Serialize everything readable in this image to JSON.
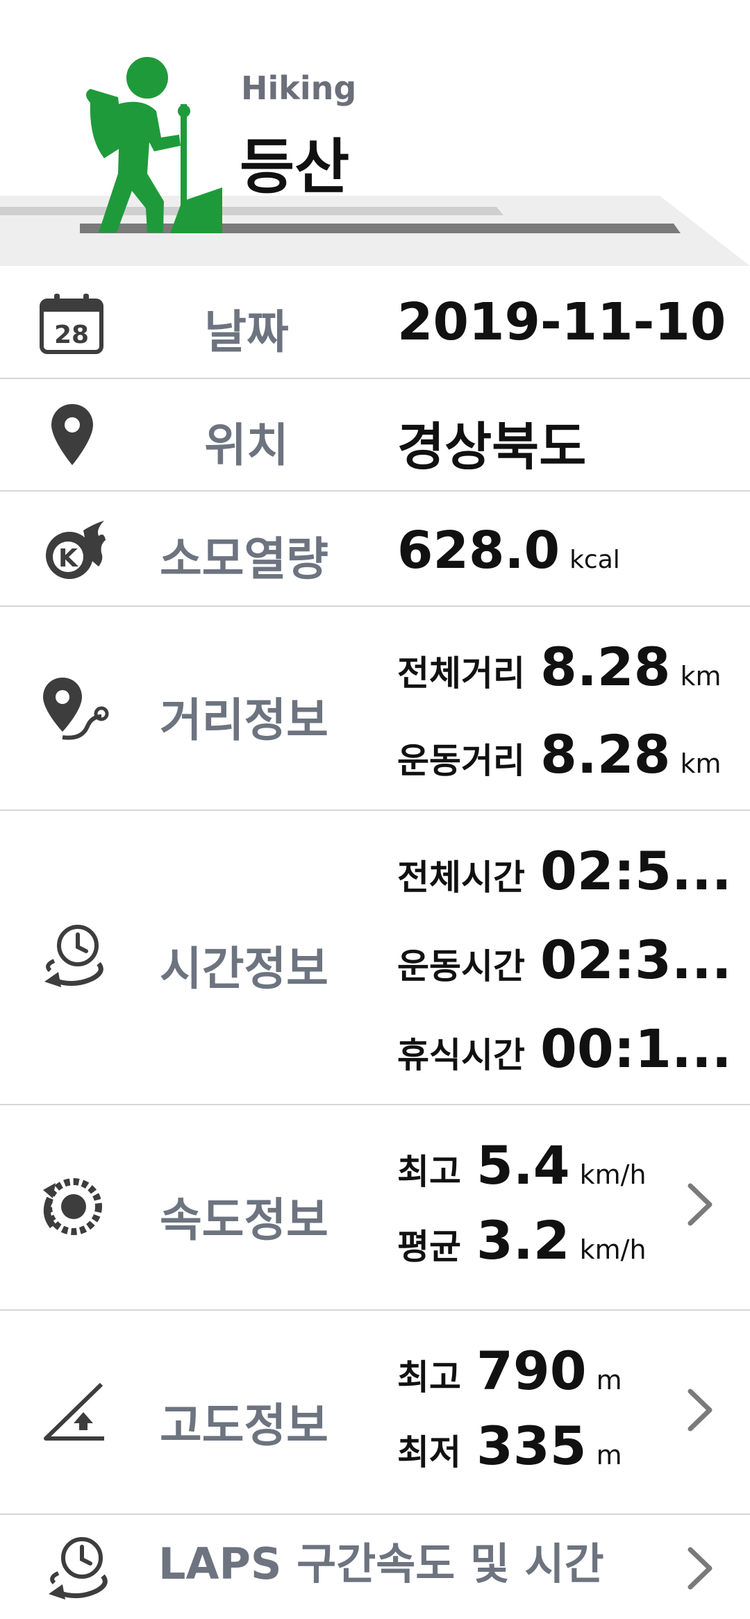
{
  "header": {
    "title_en": "Hiking",
    "title_ko": "등산"
  },
  "colors": {
    "accent_green": "#1f9a3a",
    "label_gray": "#6d7480",
    "icon_dark": "#3d3d3d"
  },
  "rows": {
    "date": {
      "icon": "calendar-icon",
      "icon_text": "28",
      "label": "날짜",
      "value": "2019-11-10"
    },
    "location": {
      "icon": "location-pin-icon",
      "label": "위치",
      "value": "경상북도"
    },
    "calories": {
      "icon": "calorie-flame-icon",
      "icon_text": "K",
      "label": "소모열량",
      "value": "628.0",
      "unit": "kcal"
    },
    "distance": {
      "icon": "route-pin-icon",
      "label": "거리정보",
      "total_key": "전체거리",
      "total_value": "8.28",
      "total_unit": "km",
      "moving_key": "운동거리",
      "moving_value": "8.28",
      "moving_unit": "km"
    },
    "time": {
      "icon": "clock-cycle-icon",
      "label": "시간정보",
      "total_key": "전체시간",
      "total_value": "02:5...",
      "moving_key": "운동시간",
      "moving_value": "02:3...",
      "rest_key": "휴식시간",
      "rest_value": "00:1..."
    },
    "speed": {
      "icon": "speedometer-icon",
      "label": "속도정보",
      "max_key": "최고",
      "max_value": "5.4",
      "max_unit": "km/h",
      "avg_key": "평균",
      "avg_value": "3.2",
      "avg_unit": "km/h"
    },
    "altitude": {
      "icon": "altitude-icon",
      "label": "고도정보",
      "max_key": "최고",
      "max_value": "790",
      "max_unit": "m",
      "min_key": "최저",
      "min_value": "335",
      "min_unit": "m"
    },
    "laps": {
      "icon": "laps-clock-icon",
      "label": "LAPS 구간속도 및 시간"
    }
  }
}
